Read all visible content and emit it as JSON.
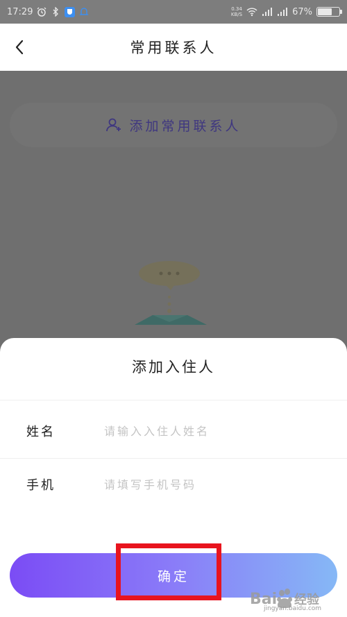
{
  "status_bar": {
    "time": "17:29",
    "net_speed_top": "0.34",
    "net_speed_bottom": "KB/S",
    "battery_percent": "67%",
    "battery_level": 0.67,
    "icons": [
      "alarm-icon",
      "bluetooth-icon",
      "shield-icon",
      "bell-icon",
      "wifi-icon",
      "signal-icon",
      "signal-4g-icon",
      "battery-icon"
    ]
  },
  "header": {
    "title": "常用联系人",
    "back_icon": "chevron-left-icon"
  },
  "content": {
    "add_contact_label": "添加常用联系人",
    "add_contact_icon": "add-user-icon"
  },
  "sheet": {
    "title": "添加入住人",
    "fields": {
      "name": {
        "label": "姓名",
        "placeholder": "请输入入住人姓名",
        "value": ""
      },
      "phone": {
        "label": "手机",
        "placeholder": "请填写手机号码",
        "value": ""
      }
    },
    "confirm_label": "确定"
  },
  "watermark": {
    "text": "Bai经验",
    "sub": "jingyan.baidu.com"
  },
  "colors": {
    "overlay": "#6f6f6f",
    "accent_purple": "#7b4cf5",
    "accent_blue": "#86b8f6",
    "highlight_red": "#e8141e"
  }
}
